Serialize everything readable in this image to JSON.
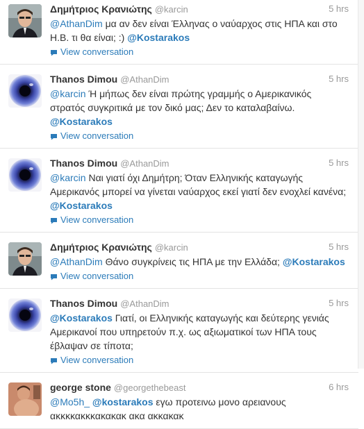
{
  "tweets": [
    {
      "fullname": "Δημήτριος Κρανιώτης",
      "username": "@karcin",
      "time": "5 hrs",
      "avatar": "person-photo",
      "parts": [
        {
          "t": "mention",
          "v": "@AthanDim"
        },
        {
          "t": "text",
          "v": " μα αν δεν είναι Έλληνας ο ναύαρχος στις ΗΠΑ και στο Η.Β. τι θα είναι; :) "
        },
        {
          "t": "strong",
          "v": "@Kostarakos"
        }
      ],
      "view": "View conversation"
    },
    {
      "fullname": "Thanos Dimou",
      "username": "@AthanDim",
      "time": "5 hrs",
      "avatar": "eye",
      "parts": [
        {
          "t": "mention",
          "v": "@karcin"
        },
        {
          "t": "text",
          "v": " Ή μήπως δεν είναι πρώτης γραμμής ο Αμερικανικός στρατός συγκριτικά με τον δικό μας; Δεν το καταλαβαίνω. "
        },
        {
          "t": "strong",
          "v": "@Kostarakos"
        }
      ],
      "view": "View conversation"
    },
    {
      "fullname": "Thanos Dimou",
      "username": "@AthanDim",
      "time": "5 hrs",
      "avatar": "eye",
      "parts": [
        {
          "t": "mention",
          "v": "@karcin"
        },
        {
          "t": "text",
          "v": " Ναι γιατί όχι Δημήτρη; Όταν Ελληνικής καταγωγής Αμερικανός μπορεί να γίνεται ναύαρχος εκεί γιατί δεν ενοχλεί κανένα; "
        },
        {
          "t": "strong",
          "v": "@Kostarakos"
        }
      ],
      "view": "View conversation"
    },
    {
      "fullname": "Δημήτριος Κρανιώτης",
      "username": "@karcin",
      "time": "5 hrs",
      "avatar": "person-photo",
      "parts": [
        {
          "t": "mention",
          "v": "@AthanDim"
        },
        {
          "t": "text",
          "v": " Θάνο συγκρίνεις τις ΗΠΑ με την Ελλάδα; "
        },
        {
          "t": "strong",
          "v": "@Kostarakos"
        }
      ],
      "view": "View conversation"
    },
    {
      "fullname": "Thanos Dimou",
      "username": "@AthanDim",
      "time": "5 hrs",
      "avatar": "eye",
      "parts": [
        {
          "t": "strong",
          "v": "@Kostarakos"
        },
        {
          "t": "text",
          "v": " Γιατί, οι Ελληνικής καταγωγής και δεύτερης γενιάς Αμερικανοί που υπηρετούν π.χ. ως αξιωματικοί των ΗΠΑ τους έβλαψαν σε τίποτα;"
        }
      ],
      "view": "View conversation"
    },
    {
      "fullname": "george stone",
      "username": "@georgethebeast",
      "time": "6 hrs",
      "avatar": "person-photo-2",
      "parts": [
        {
          "t": "mention",
          "v": "@Mo5h_"
        },
        {
          "t": "text",
          "v": " "
        },
        {
          "t": "strong",
          "v": "@kostarakos"
        },
        {
          "t": "text",
          "v": " εγω προτεινω μονο αρειανους ακκκκακκκακακακ ακα ακκακακ"
        }
      ],
      "view": ""
    }
  ],
  "colors": {
    "link": "#2b7bb9",
    "name": "#333333",
    "meta": "#999999",
    "divider": "#e3e3e3"
  }
}
